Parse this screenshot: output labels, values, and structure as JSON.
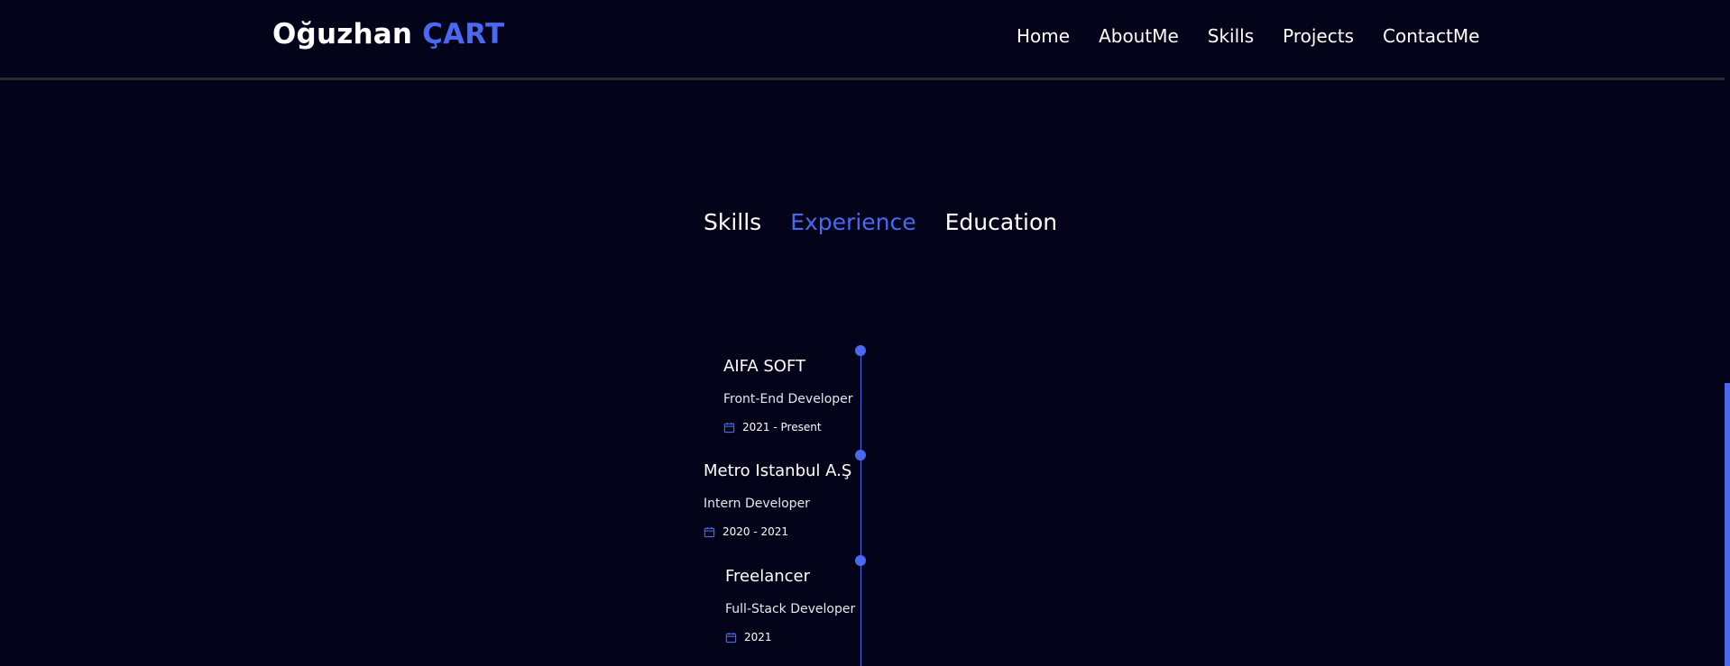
{
  "header": {
    "logo_first": "Oğuzhan",
    "logo_accent": "ÇART",
    "nav": [
      "Home",
      "AboutMe",
      "Skills",
      "Projects",
      "ContactMe"
    ]
  },
  "qualification": {
    "tabs": [
      {
        "label": "Skills",
        "active": false
      },
      {
        "label": "Experience",
        "active": true
      },
      {
        "label": "Education",
        "active": false
      }
    ],
    "entries": [
      {
        "title": "AIFA SOFT",
        "role": "Front-End Developer",
        "date": "2021 - Present",
        "icon": "calendar-icon"
      },
      {
        "title": "Metro Istanbul A.Ş",
        "role": "Intern Developer",
        "date": "2020 - 2021",
        "icon": "calendar-icon"
      },
      {
        "title": "Freelancer",
        "role": "Full-Stack Developer",
        "date": "2021",
        "icon": "calendar-icon"
      }
    ]
  },
  "colors": {
    "background": "#03041a",
    "accent": "#4a68f0",
    "text": "#ffffff"
  }
}
